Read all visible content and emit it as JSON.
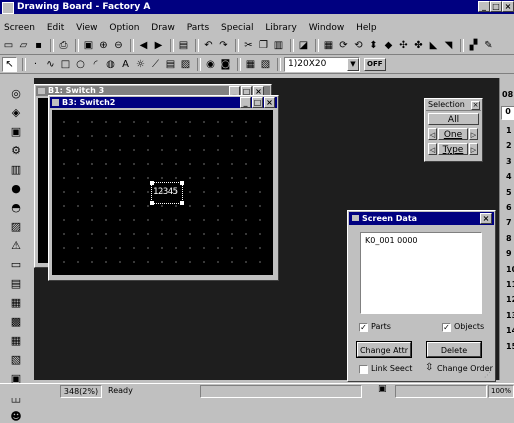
{
  "app": {
    "title": "Drawing Board - Factory A"
  },
  "menu": [
    "Screen",
    "Edit",
    "View",
    "Option",
    "Draw",
    "Parts",
    "Special",
    "Library",
    "Window",
    "Help"
  ],
  "toolbar2": {
    "zoom_value": "1)20X20",
    "off_label": "OFF"
  },
  "windows": {
    "b1_title": "B1: Switch 3",
    "b3_title": "B3: Switch2",
    "part_value": "12345"
  },
  "selection_panel": {
    "title": "Selection",
    "all_label": "All",
    "one_label": "One",
    "type_label": "Type"
  },
  "screen_data": {
    "title": "Screen Data",
    "list_items": [
      "K0_001 0000"
    ],
    "parts_label": "Parts",
    "parts_checked": true,
    "objects_label": "Objects",
    "objects_checked": true,
    "change_attr_label": "Change Attr",
    "delete_label": "Delete",
    "link_select_label": "Link Seect",
    "link_select_checked": false,
    "change_order_label": "Change Order"
  },
  "right_panel": {
    "header": "08",
    "tab": "0",
    "rows": [
      "1",
      "2",
      "3",
      "4",
      "5",
      "6",
      "7",
      "8",
      "9",
      "10",
      "11",
      "12",
      "13",
      "14",
      "15"
    ]
  },
  "status": {
    "coords": "348(2%)",
    "message": "Ready",
    "zoom": "100%"
  },
  "colors": {
    "titlebar": "#000080",
    "face": "#c0c0c0",
    "canvas": "#000000",
    "workspace": "#202020"
  }
}
